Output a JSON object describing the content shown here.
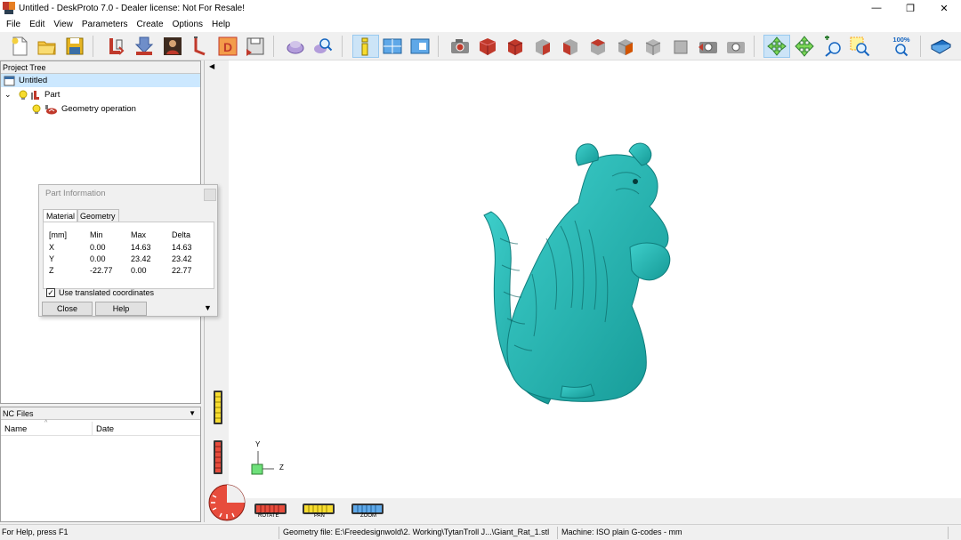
{
  "window": {
    "title": "Untitled - DeskProto 7.0 - Dealer license: Not For Resale!",
    "minimize_glyph": "—",
    "restore_glyph": "❐",
    "close_glyph": "✕"
  },
  "menu": [
    "File",
    "Edit",
    "View",
    "Parameters",
    "Create",
    "Options",
    "Help"
  ],
  "toolbar": {
    "zoom_label": "100%"
  },
  "project_tree": {
    "title": "Project Tree",
    "root": "Untitled",
    "part": "Part",
    "operation": "Geometry operation"
  },
  "nc_files": {
    "title": "NC Files",
    "col_name": "Name",
    "col_date": "Date"
  },
  "part_info": {
    "title": "Part Information",
    "tabs": [
      "Material",
      "Geometry"
    ],
    "headers": [
      "[mm]",
      "Min",
      "Max",
      "Delta"
    ],
    "rows": [
      [
        "X",
        "0.00",
        "14.63",
        "14.63"
      ],
      [
        "Y",
        "0.00",
        "23.42",
        "23.42"
      ],
      [
        "Z",
        "-22.77",
        "0.00",
        "22.77"
      ]
    ],
    "checkbox_label": "Use translated coordinates",
    "checkbox_checked": true,
    "close_button": "Close",
    "help_button": "Help"
  },
  "view_controls": {
    "rotate": "ROTATE",
    "pan": "PAN",
    "zoom": "ZOOM"
  },
  "axes": {
    "y": "Y",
    "z": "Z"
  },
  "statusbar": {
    "help": "For Help, press F1",
    "geometry_file": "Geometry file: E:\\Freedesignwold\\2. Working\\TytanTroll J...\\Giant_Rat_1.stl",
    "machine": "Machine: ISO plain G-codes - mm"
  },
  "colors": {
    "model": "#1fb3b0",
    "model_dark": "#0f7d7c",
    "selection": "#cce8ff",
    "toolbar_active": "#cce4f7"
  }
}
